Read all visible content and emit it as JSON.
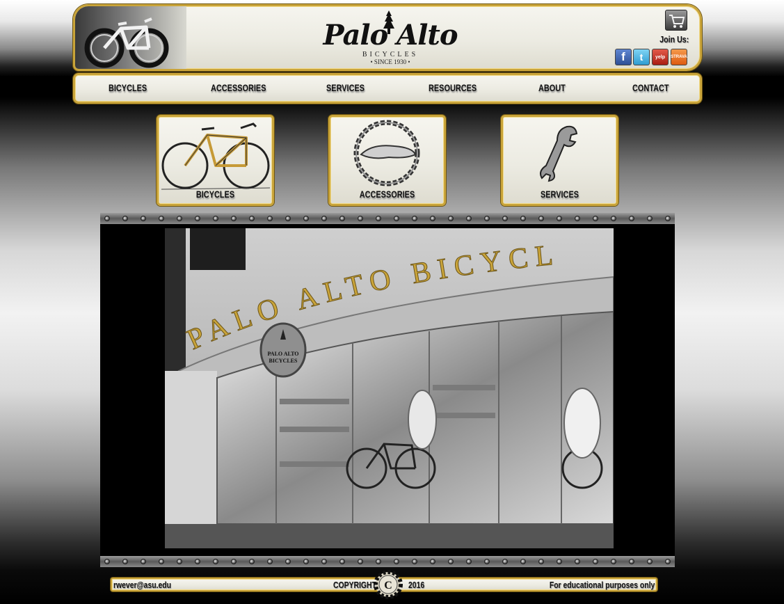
{
  "header": {
    "brand": "Palo Alto",
    "brand_sub": "BICYCLES",
    "brand_since": "• SINCE 1930 •",
    "join_label": "Join Us:",
    "social": [
      "facebook-icon",
      "twitter-icon",
      "yelp-icon",
      "strava-icon"
    ],
    "yelp_text": "yelp",
    "strava_text": "STRAVA"
  },
  "nav": {
    "items": [
      "BICYCLES",
      "ACCESSORIES",
      "SERVICES",
      "RESOURCES",
      "ABOUT",
      "CONTACT"
    ]
  },
  "tiles": [
    {
      "label": "BICYCLES",
      "icon": "bicycle-icon"
    },
    {
      "label": "ACCESSORIES",
      "icon": "saddle-chain-icon"
    },
    {
      "label": "SERVICES",
      "icon": "wrench-icon"
    }
  ],
  "photo": {
    "sign_text": "PALO ALTO BICYCLES",
    "hanging_sign": "PALO ALTO BICYCLES"
  },
  "footer": {
    "email": "rwever@asu.edu",
    "copyright": "COPYRIGHT",
    "year": "2016",
    "badge": "C",
    "note": "For educational purposes only"
  },
  "colors": {
    "accent_gold": "#c9a43a",
    "panel_bg": "#ecebe2"
  }
}
